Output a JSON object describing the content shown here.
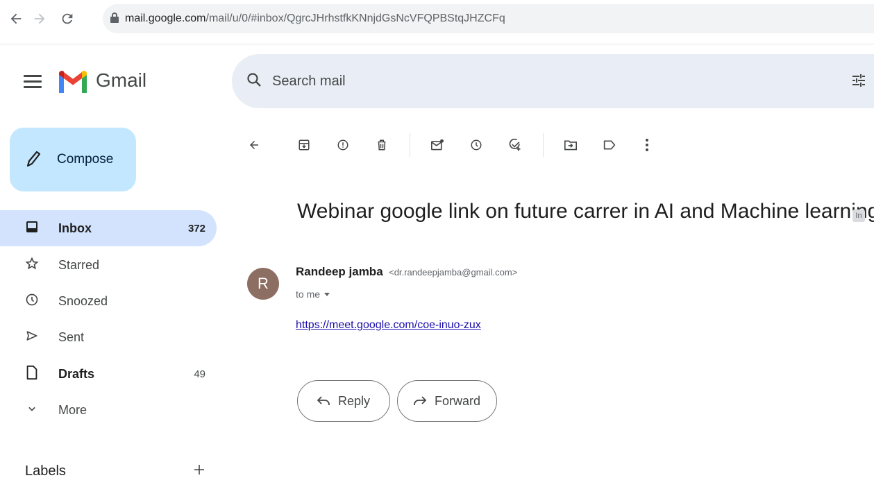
{
  "browser": {
    "url_host": "mail.google.com",
    "url_path": "/mail/u/0/#inbox/QgrcJHrhstfkKNnjdGsNcVFQPBStqJHZCFq"
  },
  "app": {
    "name": "Gmail"
  },
  "search": {
    "placeholder": "Search mail"
  },
  "sidebar": {
    "compose_label": "Compose",
    "items": [
      {
        "label": "Inbox",
        "count": "372",
        "icon": "inbox-icon",
        "active": true
      },
      {
        "label": "Starred",
        "count": "",
        "icon": "star-icon"
      },
      {
        "label": "Snoozed",
        "count": "",
        "icon": "clock-icon"
      },
      {
        "label": "Sent",
        "count": "",
        "icon": "send-icon"
      },
      {
        "label": "Drafts",
        "count": "49",
        "icon": "draft-icon"
      },
      {
        "label": "More",
        "count": "",
        "icon": "chevron-down-icon"
      }
    ],
    "labels_title": "Labels"
  },
  "toolbar": {
    "icons": [
      "back-arrow-icon",
      "archive-icon",
      "report-spam-icon",
      "delete-icon",
      "mark-unread-icon",
      "snooze-icon",
      "add-task-icon",
      "move-to-icon",
      "label-icon",
      "more-vert-icon"
    ]
  },
  "message": {
    "subject": "Webinar google link on future carrer in AI and Machine learning",
    "subject_chip": "In",
    "avatar_letter": "R",
    "sender_name": "Randeep jamba",
    "sender_email": "<dr.randeepjamba@gmail.com>",
    "to_line": "to me",
    "body_link": "https://meet.google.com/coe-inuo-zux"
  },
  "actions": {
    "reply_label": "Reply",
    "forward_label": "Forward"
  },
  "colors": {
    "compose_bg": "#c2e7ff",
    "active_item_bg": "#d3e3fd",
    "search_bg": "#e9eef6",
    "avatar_bg": "#8d6e63",
    "link": "#1a0dab"
  }
}
